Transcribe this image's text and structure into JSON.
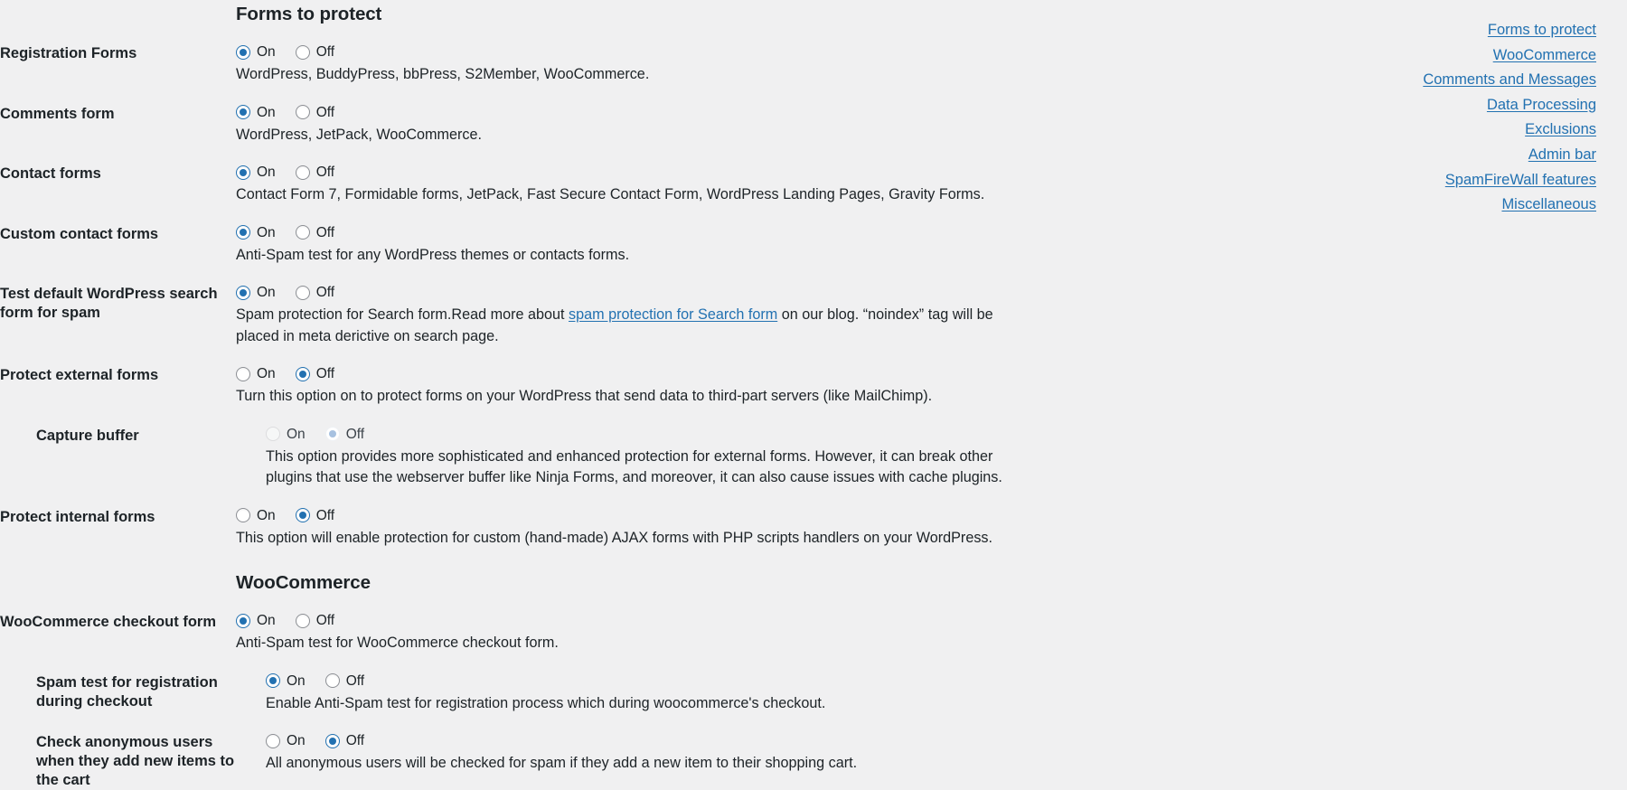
{
  "anchor_nav": {
    "links": [
      {
        "label": "Forms to protect"
      },
      {
        "label": "WooCommerce"
      },
      {
        "label": "Comments and Messages"
      },
      {
        "label": "Data Processing"
      },
      {
        "label": "Exclusions"
      },
      {
        "label": "Admin bar"
      },
      {
        "label": "SpamFireWall features"
      },
      {
        "label": "Miscellaneous"
      }
    ]
  },
  "sections": {
    "forms_to_protect": {
      "heading": "Forms to protect",
      "rows": [
        {
          "label": "Registration Forms",
          "on_label": "On",
          "off_label": "Off",
          "selected": "on",
          "disabled": false,
          "indented": false,
          "description": "WordPress, BuddyPress, bbPress, S2Member, WooCommerce."
        },
        {
          "label": "Comments form",
          "on_label": "On",
          "off_label": "Off",
          "selected": "on",
          "disabled": false,
          "indented": false,
          "description": "WordPress, JetPack, WooCommerce."
        },
        {
          "label": "Contact forms",
          "on_label": "On",
          "off_label": "Off",
          "selected": "on",
          "disabled": false,
          "indented": false,
          "description": "Contact Form 7, Formidable forms, JetPack, Fast Secure Contact Form, WordPress Landing Pages, Gravity Forms."
        },
        {
          "label": "Custom contact forms",
          "on_label": "On",
          "off_label": "Off",
          "selected": "on",
          "disabled": false,
          "indented": false,
          "description": "Anti-Spam test for any WordPress themes or contacts forms."
        },
        {
          "label": "Test default WordPress search form for spam",
          "on_label": "On",
          "off_label": "Off",
          "selected": "on",
          "disabled": false,
          "indented": false,
          "description_before_link": "Spam protection for Search form.Read more about ",
          "description_link": "spam protection for Search form",
          "description_after_link": " on our blog. “noindex” tag will be placed in meta derictive on search page."
        },
        {
          "label": "Protect external forms",
          "on_label": "On",
          "off_label": "Off",
          "selected": "off",
          "disabled": false,
          "indented": false,
          "description": "Turn this option on to protect forms on your WordPress that send data to third-part servers (like MailChimp)."
        },
        {
          "label": "Capture buffer",
          "on_label": "On",
          "off_label": "Off",
          "selected": "off",
          "disabled": true,
          "indented": true,
          "description": "This option provides more sophisticated and enhanced protection for external forms. However, it can break other plugins that use the webserver buffer like Ninja Forms, and moreover, it can also cause issues with cache plugins."
        },
        {
          "label": "Protect internal forms",
          "on_label": "On",
          "off_label": "Off",
          "selected": "off",
          "disabled": false,
          "indented": false,
          "description": "This option will enable protection for custom (hand-made) AJAX forms with PHP scripts handlers on your WordPress."
        }
      ]
    },
    "woocommerce": {
      "heading": "WooCommerce",
      "rows": [
        {
          "label": "WooCommerce checkout form",
          "on_label": "On",
          "off_label": "Off",
          "selected": "on",
          "disabled": false,
          "indented": false,
          "description": "Anti-Spam test for WooCommerce checkout form."
        },
        {
          "label": "Spam test for registration during checkout",
          "on_label": "On",
          "off_label": "Off",
          "selected": "on",
          "disabled": false,
          "indented": true,
          "description": "Enable Anti-Spam test for registration process which during woocommerce's checkout."
        },
        {
          "label": "Check anonymous users when they add new items to the cart",
          "on_label": "On",
          "off_label": "Off",
          "selected": "off",
          "disabled": false,
          "indented": true,
          "description": "All anonymous users will be checked for spam if they add a new item to their shopping cart."
        }
      ]
    }
  },
  "colors": {
    "background": "#f0f0f1",
    "link": "#2271b1",
    "text": "#1d2327",
    "radio_border": "#8c8f94"
  }
}
